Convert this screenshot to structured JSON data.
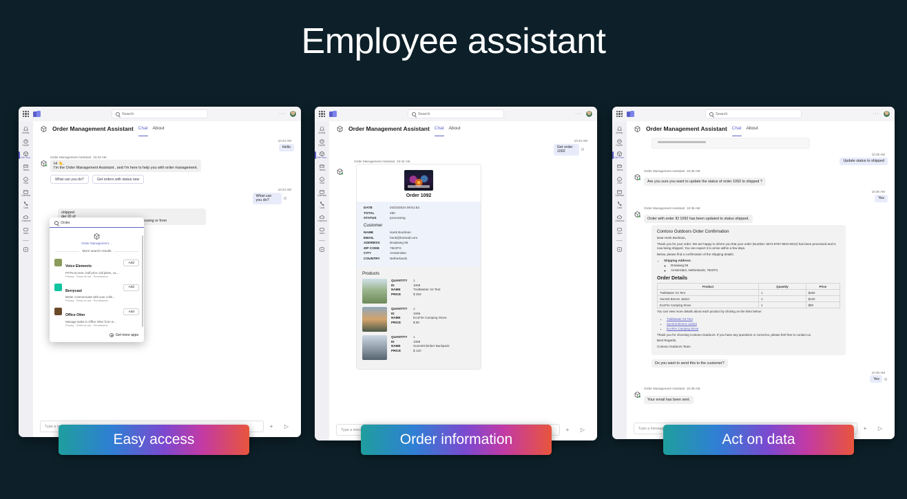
{
  "page": {
    "title": "Employee assistant"
  },
  "window": {
    "search_placeholder": "Search",
    "app_name": "Order Management Assistant",
    "tab_chat": "Chat",
    "tab_about": "About",
    "more_label": "···"
  },
  "rail": {
    "items": [
      {
        "label": "Activity",
        "icon": "bell-icon"
      },
      {
        "label": "Copilot",
        "icon": "copilot-icon"
      },
      {
        "label": "Order Man...",
        "icon": "order-bot-icon"
      },
      {
        "label": "Teams",
        "icon": "teams-icon"
      },
      {
        "label": "Chat",
        "icon": "chat-icon"
      },
      {
        "label": "Calendar",
        "icon": "calendar-icon"
      },
      {
        "label": "Calls",
        "icon": "phone-icon"
      },
      {
        "label": "OneDrive",
        "icon": "cloud-icon"
      },
      {
        "label": "More",
        "icon": "more-apps-icon"
      }
    ],
    "apps_label": "Apps"
  },
  "composer": {
    "placeholder": "Type a message",
    "attach": "+",
    "send": "▷"
  },
  "panel1": {
    "badge": "Easy access",
    "messages": [
      {
        "dir": "out",
        "time": "10:24 AM",
        "text": "Hello"
      },
      {
        "dir": "in",
        "sender": "Order Management Assistant",
        "time": "10:24 AM",
        "line1": "Hi 👋,",
        "line2": "I'm the Order Management Assistant , and I'm here to help you with order management."
      },
      {
        "dir": "out",
        "time": "10:24 AM",
        "text": "What can you do?"
      },
      {
        "dir": "in",
        "sender": "Order Management Assistant",
        "time": "10:24 AM",
        "line1": "shipped",
        "line2": "der ID of",
        "line3": "ke for instance: change an order from new to processing or from"
      }
    ],
    "suggestions": [
      "What can you do?",
      "Get orders with status new"
    ],
    "dropdown": {
      "search_value": "Order",
      "top_app": "Order Management ...",
      "section_label": "More search results",
      "apps": [
        {
          "name": "Voice Elements",
          "desc": "PSTN access, half price call plans, ca...",
          "links": "Privacy · Terms of use · Permissions",
          "action": "Add",
          "color": "#8a9b5a"
        },
        {
          "name": "Berrycast",
          "desc": "Better communicate with your colle...",
          "links": "Privacy · Terms of use · Permissions",
          "action": "Add",
          "color": "#0fc4a0"
        },
        {
          "name": "Office Otter",
          "desc": "Manage tasks in Office Otter from w...",
          "links": "Privacy · Terms of use · Permissions",
          "action": "Add",
          "color": "#6b4a2a"
        }
      ],
      "footer": "Get more apps"
    }
  },
  "panel2": {
    "badge": "Order information",
    "user_msg": {
      "time": "10:34 AM",
      "text": "Get order 1092"
    },
    "bot_hdr": {
      "sender": "Order Management Assistant",
      "time": "10:34 AM"
    },
    "card": {
      "title": "Order 1092",
      "fields": [
        {
          "k": "DATE",
          "v": "04/23/2024 09:51:52"
        },
        {
          "k": "TOTAL",
          "v": "450"
        },
        {
          "k": "STATUS",
          "v": "processing"
        }
      ],
      "customer_label": "Customer",
      "customer": [
        {
          "k": "NAME",
          "v": "Hank Boelman"
        },
        {
          "k": "EMAIL",
          "v": "henk@hotmail.com"
        },
        {
          "k": "ADDRESS",
          "v": "Draaiweg 56"
        },
        {
          "k": "ZIP CODE",
          "v": "7823TG"
        },
        {
          "k": "CITY",
          "v": "Amsterdam"
        },
        {
          "k": "COUNTRY",
          "v": "Netherlands"
        }
      ],
      "products_label": "Products",
      "products": [
        {
          "quantity": "1",
          "id": "1069",
          "name": "TrailMaster X4 Tent",
          "price": "$ 250"
        },
        {
          "quantity": "1",
          "id": "1066",
          "name": "EcoFire Camping Stove",
          "price": "$ 80"
        },
        {
          "quantity": "1",
          "id": "1069",
          "name": "SummitClimber Backpack",
          "price": "$ 120"
        }
      ],
      "keys": {
        "quantity": "QUANTITY",
        "id": "ID",
        "name": "NAME",
        "price": "PRICE"
      }
    }
  },
  "panel3": {
    "badge": "Act on data",
    "messages": [
      {
        "dir": "out",
        "time": "10:35 AM",
        "text": "Update status to shipped"
      },
      {
        "dir": "in",
        "sender": "Order Management Assistant",
        "time": "10:36 AM",
        "text": "Are you sure you want to update the status of order 1092 to shipped ?"
      },
      {
        "dir": "out",
        "time": "10:36 AM",
        "text": "Yes"
      },
      {
        "dir": "in",
        "sender": "Order Management Assistant",
        "time": "10:36 AM",
        "text": "Order with order ID 1092 has been updated to status shipped."
      }
    ],
    "email": {
      "heading": "Contoso Outdoors Order Confirmation",
      "greeting": "Dear Henk Boelman,",
      "para1": "Thank you for your order. We are happy to inform you that your order (Number: 5674-8767-8910-0012) has been processed and is now being shipped. You can expect it to arrive within a few days.",
      "para2": "Below, please find a confirmation of the shipping details:",
      "ship_label": "Shipping Address:",
      "ship_lines": [
        "Draaiweg 56",
        "Amsterdam, Netherlands, 7823TG"
      ],
      "details_heading": "Order Details",
      "table_headers": [
        "Product",
        "Quantity",
        "Price"
      ],
      "table_rows": [
        [
          "TrailMaster X4 Tent",
          "1",
          "$250"
        ],
        [
          "Summit Breeze Jacket",
          "1",
          "$120"
        ],
        [
          "EcoFire Camping Stove",
          "1",
          "$80"
        ]
      ],
      "links_intro": "You can view more details about each product by clicking on the links below:",
      "links": [
        "TrailMaster X4 Tent",
        "Summit Breeze Jacket",
        "EcoFire Camping Stove"
      ],
      "closing1": "Thank you for choosing Contoso Outdoors. If you have any questions or concerns, please feel free to contact us.",
      "closing2": "Best Regards,",
      "closing3": "Contoso Outdoors Team"
    },
    "confirm_prompt": "Do you want to send this to the customer?",
    "confirm_yes": {
      "time": "10:36 AM",
      "text": "Yes"
    },
    "final": {
      "sender": "Order Management Assistant",
      "time": "10:36 AM",
      "text": "Your email has been sent."
    }
  }
}
